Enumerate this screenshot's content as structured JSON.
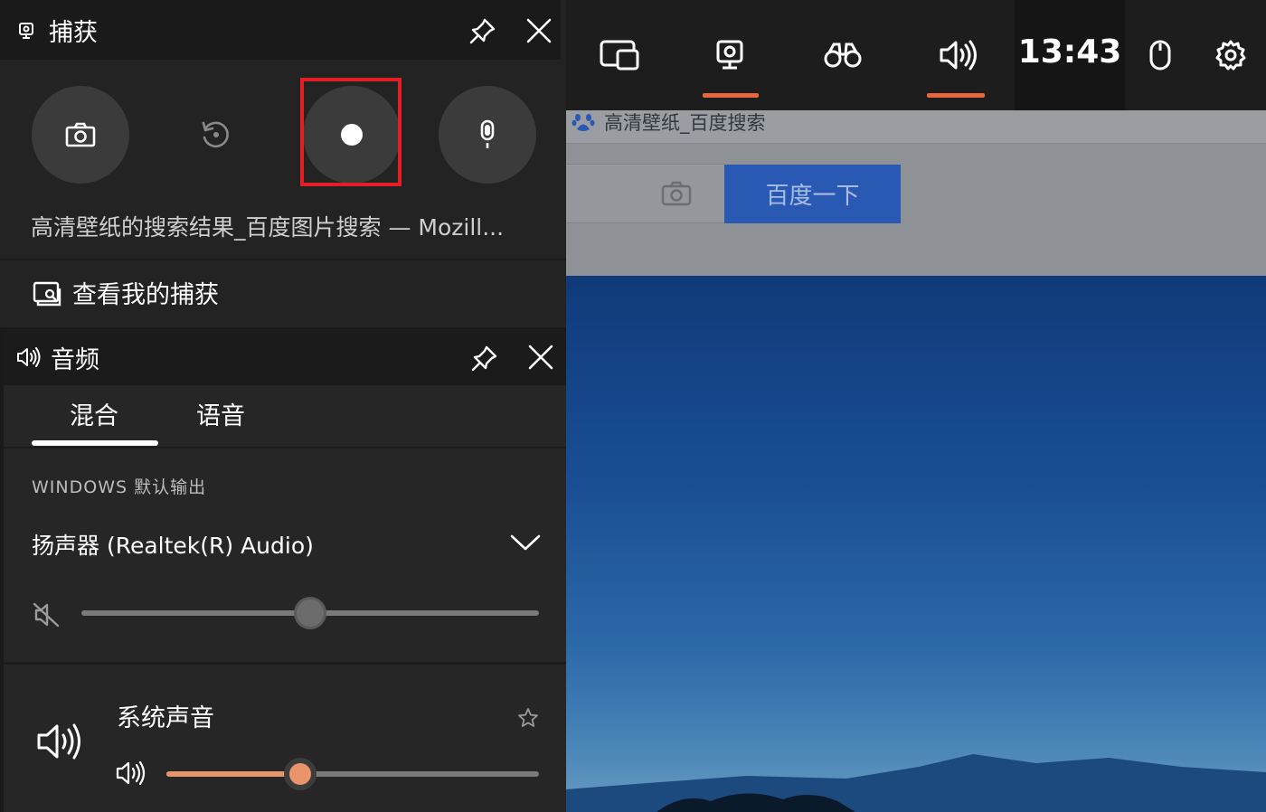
{
  "browser": {
    "tab_title": "高清壁纸_百度搜索",
    "search_button": "百度一下"
  },
  "gamebar": {
    "clock": "13:43",
    "widgets": [
      "widget-menu-icon",
      "capture-icon",
      "looking-for-group-icon",
      "audio-icon",
      "mouse-icon",
      "gear-icon"
    ],
    "active_widgets": [
      "capture",
      "audio"
    ],
    "accent_color": "#e8663a"
  },
  "capture": {
    "title": "捕获",
    "buttons": [
      "screenshot",
      "record-last-30s",
      "start-recording",
      "microphone"
    ],
    "window_title": "高清壁纸的搜索结果_百度图片搜索 — Mozill...",
    "view_captures": "查看我的捕获",
    "highlight_color": "#e41e25"
  },
  "audio": {
    "title": "音频",
    "tabs": [
      {
        "label": "混合",
        "active": true
      },
      {
        "label": "语音",
        "active": false
      }
    ],
    "section_label": "WINDOWS 默认输出",
    "device": "扬声器 (Realtek(R) Audio)",
    "master_volume": {
      "percent": 50,
      "muted": true
    },
    "apps": [
      {
        "name": "系统声音",
        "volume_percent": 36,
        "favorite": false
      }
    ],
    "fill_color": "#e8956c"
  }
}
